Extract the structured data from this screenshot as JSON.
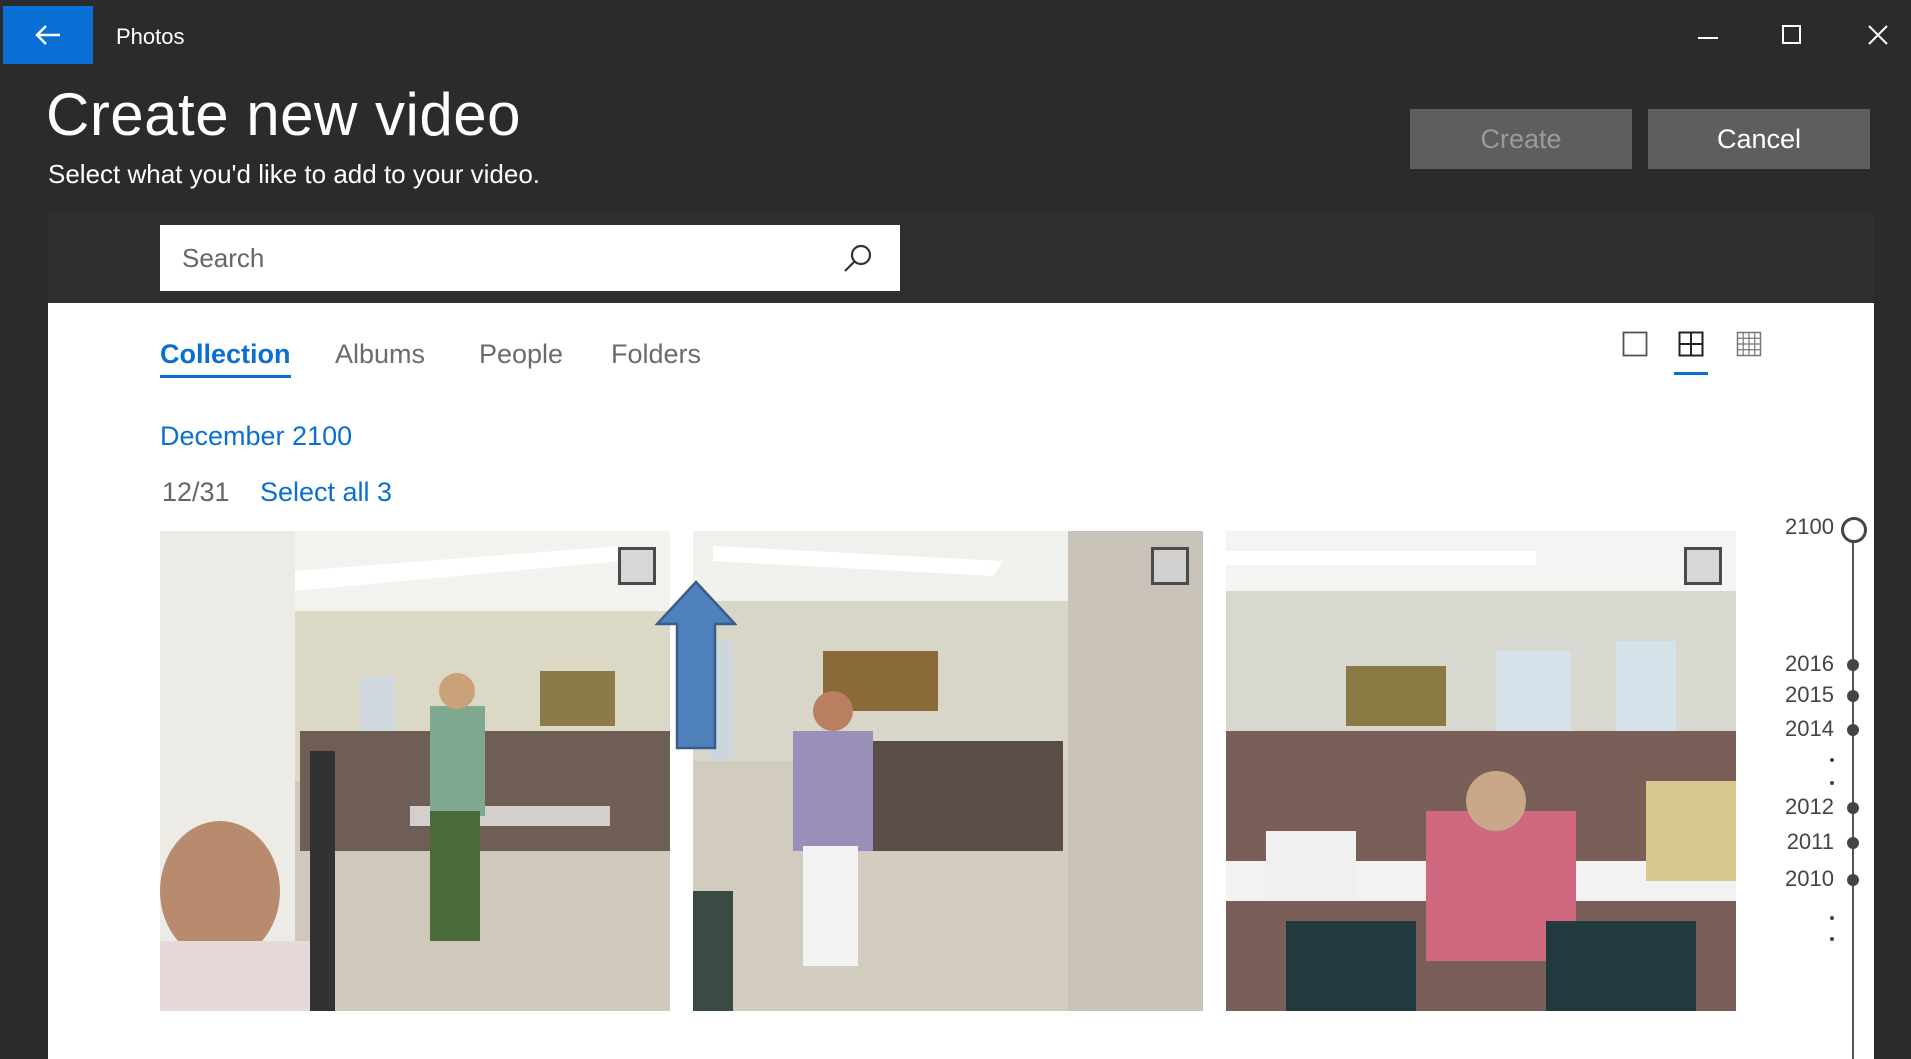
{
  "app": {
    "title": "Photos"
  },
  "page": {
    "title": "Create new video",
    "subtitle": "Select what you'd like to add to your video."
  },
  "buttons": {
    "create": "Create",
    "cancel": "Cancel"
  },
  "search": {
    "placeholder": "Search",
    "value": ""
  },
  "tabs": [
    {
      "label": "Collection",
      "active": true
    },
    {
      "label": "Albums",
      "active": false
    },
    {
      "label": "People",
      "active": false
    },
    {
      "label": "Folders",
      "active": false
    }
  ],
  "view_options": [
    {
      "icon": "single-square-view-icon",
      "active": false
    },
    {
      "icon": "medium-grid-view-icon",
      "active": true
    },
    {
      "icon": "small-grid-view-icon",
      "active": false
    }
  ],
  "gallery": {
    "month": "December 2100",
    "date": "12/31",
    "select_all": "Select all 3",
    "photos": [
      {
        "description": "woman-in-green-standing-in-hall",
        "selected": false
      },
      {
        "description": "woman-in-purple-top-walking",
        "selected": false
      },
      {
        "description": "group-seated-at-tables",
        "selected": false
      }
    ]
  },
  "timeline": {
    "years": [
      "2100",
      "2016",
      "2015",
      "2014",
      "2012",
      "2011",
      "2010"
    ]
  },
  "colors": {
    "accent": "#0a6fd4",
    "window_bg": "#2b2b2b",
    "button_bg": "#5e5e5e",
    "arrow_fill": "#4f81bd",
    "arrow_stroke": "#385d8a"
  }
}
